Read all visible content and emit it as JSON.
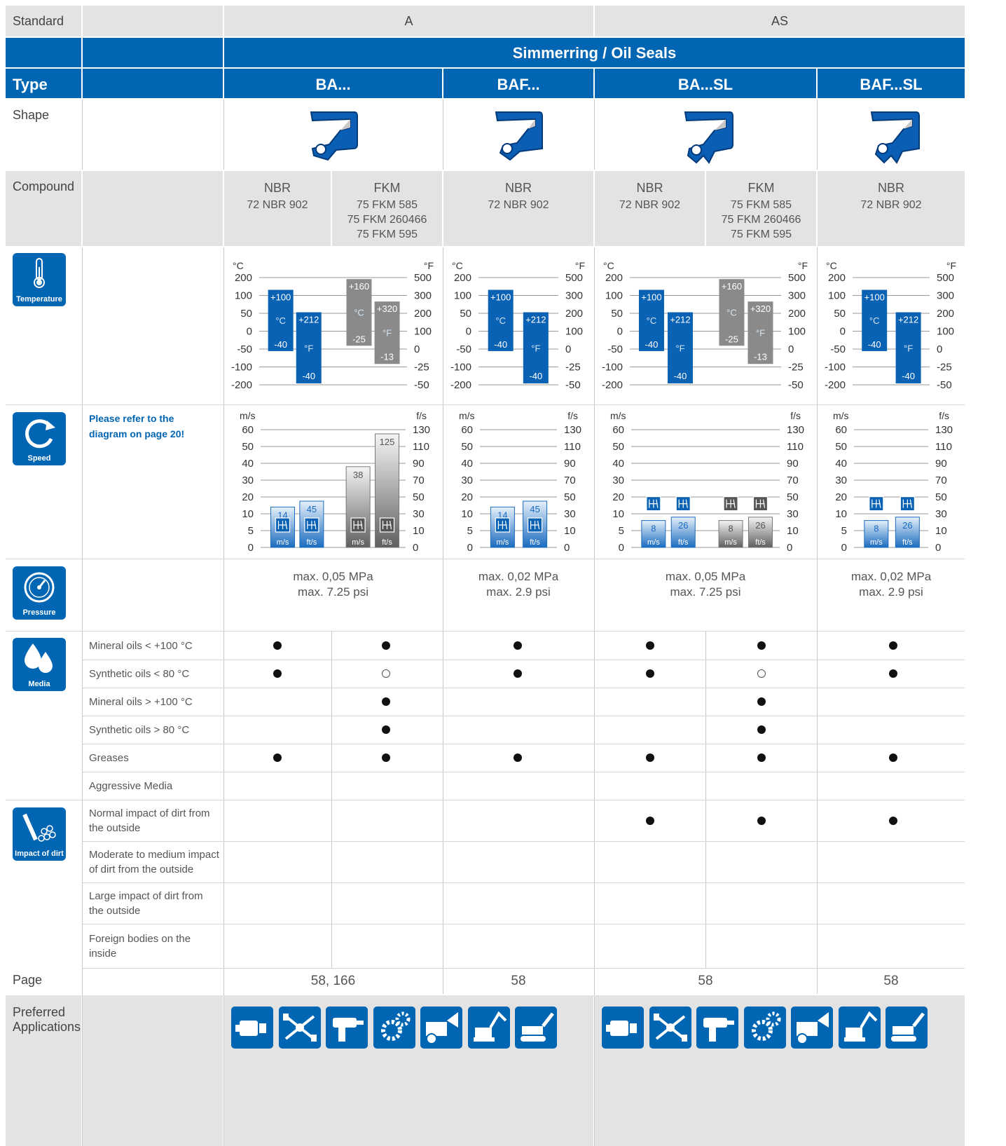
{
  "header": {
    "standard_label": "Standard",
    "standard_a": "A",
    "standard_as": "AS",
    "band_title": "Simmerring / Oil Seals",
    "type_label": "Type",
    "types": [
      "BA...",
      "BAF...",
      "BA...SL",
      "BAF...SL"
    ]
  },
  "rows": {
    "shape": "Shape",
    "compound": "Compound",
    "page": "Page",
    "preferred": "Preferred Applications"
  },
  "compounds": [
    {
      "main": "NBR",
      "subs": [
        "72 NBR 902"
      ]
    },
    {
      "main": "FKM",
      "subs": [
        "75 FKM 585",
        "75 FKM 260466",
        "75 FKM 595"
      ]
    },
    {
      "main": "NBR",
      "subs": [
        "72 NBR 902"
      ]
    },
    {
      "main": "NBR",
      "subs": [
        "72 NBR 902"
      ]
    },
    {
      "main": "FKM",
      "subs": [
        "75 FKM 585",
        "75 FKM 260466",
        "75 FKM 595"
      ]
    },
    {
      "main": "NBR",
      "subs": [
        "72 NBR 902"
      ]
    }
  ],
  "icons": {
    "temperature": "Temperature",
    "speed": "Speed",
    "pressure": "Pressure",
    "media": "Media",
    "dirt": "Impact of dirt"
  },
  "speed_note": "Please refer to the diagram on page 20!",
  "temperature_charts": {
    "unit_left": "°C",
    "unit_right": "°F",
    "ticks_c": [
      "200",
      "100",
      "50",
      "0",
      "-50",
      "-100",
      "-200"
    ],
    "ticks_f": [
      "500",
      "300",
      "200",
      "100",
      "0",
      "-25",
      "-50"
    ],
    "nbr": {
      "c_max": "+100",
      "c_min": "-40",
      "f_max": "+212",
      "f_min": "-40",
      "c_unit": "°C",
      "f_unit": "°F"
    },
    "fkm": {
      "c_max": "+160",
      "c_min": "-25",
      "f_max": "+320",
      "f_min": "-13",
      "c_unit": "°C",
      "f_unit": "°F"
    }
  },
  "speed_charts": {
    "unit_left": "m/s",
    "unit_right": "f/s",
    "ticks_ms": [
      "60",
      "50",
      "40",
      "30",
      "20",
      "10",
      "5",
      "0"
    ],
    "ticks_fs": [
      "130",
      "110",
      "90",
      "70",
      "50",
      "30",
      "10",
      "0"
    ],
    "bar_unit_ms": "m/s",
    "bar_unit_fts": "ft/s",
    "groups": [
      {
        "ms": "14",
        "fs": "45"
      },
      {
        "ms": "38",
        "fs": "125"
      },
      {
        "ms": "14",
        "fs": "45"
      },
      {
        "ms": "8",
        "fs": "26"
      },
      {
        "ms": "8",
        "fs": "26"
      },
      {
        "ms": "8",
        "fs": "26"
      }
    ]
  },
  "pressure": [
    {
      "line1": "max. 0,05 MPa",
      "line2": "max. 7.25 psi"
    },
    {
      "line1": "max. 0,02 MPa",
      "line2": "max. 2.9 psi"
    },
    {
      "line1": "max. 0,05 MPa",
      "line2": "max. 7.25 psi"
    },
    {
      "line1": "max. 0,02 MPa",
      "line2": "max. 2.9 psi"
    }
  ],
  "media": {
    "labels": [
      "Mineral oils < +100 °C",
      "Synthetic oils < 80 °C",
      "Mineral oils > +100 °C",
      "Synthetic oils > 80 °C",
      "Greases",
      "Aggressive Media"
    ],
    "marks": [
      [
        "full",
        "full",
        "full",
        "full",
        "full",
        "full"
      ],
      [
        "full",
        "open",
        "full",
        "full",
        "open",
        "full"
      ],
      [
        "",
        "full",
        "",
        "",
        "full",
        ""
      ],
      [
        "",
        "full",
        "",
        "",
        "full",
        ""
      ],
      [
        "full",
        "full",
        "full",
        "full",
        "full",
        "full"
      ],
      [
        "",
        "",
        "",
        "",
        "",
        ""
      ]
    ]
  },
  "dirt": {
    "labels": [
      "Normal impact of dirt from the outside",
      "Moderate to medium impact of dirt from the outside",
      "Large impact of dirt from the outside",
      "Foreign bodies on the inside"
    ],
    "marks": [
      [
        "",
        "",
        "",
        "full",
        "full",
        "full"
      ],
      [
        "",
        "",
        "",
        "",
        "",
        ""
      ],
      [
        "",
        "",
        "",
        "",
        "",
        ""
      ],
      [
        "",
        "",
        "",
        "",
        "",
        ""
      ]
    ]
  },
  "pages": [
    "58, 166",
    "58",
    "58",
    "58"
  ],
  "applications": [
    "gear-motor-icon",
    "axle-icon",
    "drill-icon",
    "gears-icon",
    "agricultural-machine-icon",
    "excavator-icon",
    "crawler-icon"
  ],
  "colors": {
    "brand_blue": "#0065b3",
    "header_gray": "#e3e3e3",
    "bar_gray": "#8a8a8a"
  }
}
